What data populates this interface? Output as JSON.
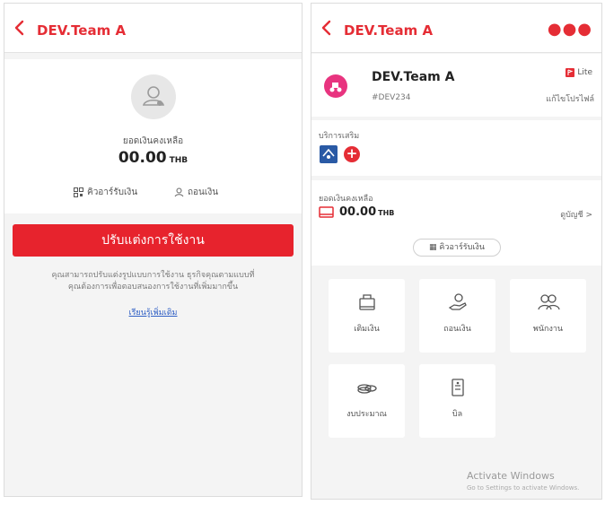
{
  "left": {
    "header_title": "DEV.Team A",
    "balance_label": "ยอดเงินคงเหลือ",
    "balance_amount": "00.00",
    "currency": "THB",
    "qr_receive_label": "คิวอาร์รับเงิน",
    "withdraw_label": "ถอนเงิน",
    "cta_label": "ปรับแต่งการใช้งาน",
    "description_line1": "คุณสามารถปรับแต่งรูปแบบการใช้งาน ธุรกิจคุณตามแบบที่",
    "description_line2": "คุณต้องการเพื่อตอบสนองการใช้งานที่เพิ่มมากขึ้น",
    "learn_more": "เรียนรู้เพิ่มเติม",
    "icons": [
      "chevron-left-icon",
      "user-icon",
      "qr-code-icon",
      "withdraw-icon"
    ]
  },
  "right": {
    "header_title": "DEV.Team A",
    "business_name": "DEV.Team A",
    "business_id": "#DEV234",
    "plan_badge": "Lite",
    "edit_profile": "แก้ไขโปรไฟล์",
    "services_label": "บริการเสริม",
    "balance_label": "ยอดเงินคงเหลือ",
    "balance_amount": "00.00",
    "currency": "THB",
    "view_account": "ดูบัญชี",
    "qr_receive_label": "คิวอาร์รับเงิน",
    "tiles": [
      {
        "label": "เติมเงิน",
        "icon": "top-up-icon"
      },
      {
        "label": "ถอนเงิน",
        "icon": "withdraw-icon"
      },
      {
        "label": "พนักงาน",
        "icon": "employees-icon"
      },
      {
        "label": "งบประมาณ",
        "icon": "budget-icon"
      },
      {
        "label": "บิล",
        "icon": "bill-icon"
      }
    ],
    "watermark_title": "Activate Windows",
    "watermark_sub": "Go to Settings to activate Windows."
  },
  "colors": {
    "accent_red": "#e52d35",
    "cta_red": "#e7232d",
    "link_blue": "#2f5fc4",
    "avatar_pink": "#e8347f",
    "service_blue": "#2a5aa5"
  }
}
